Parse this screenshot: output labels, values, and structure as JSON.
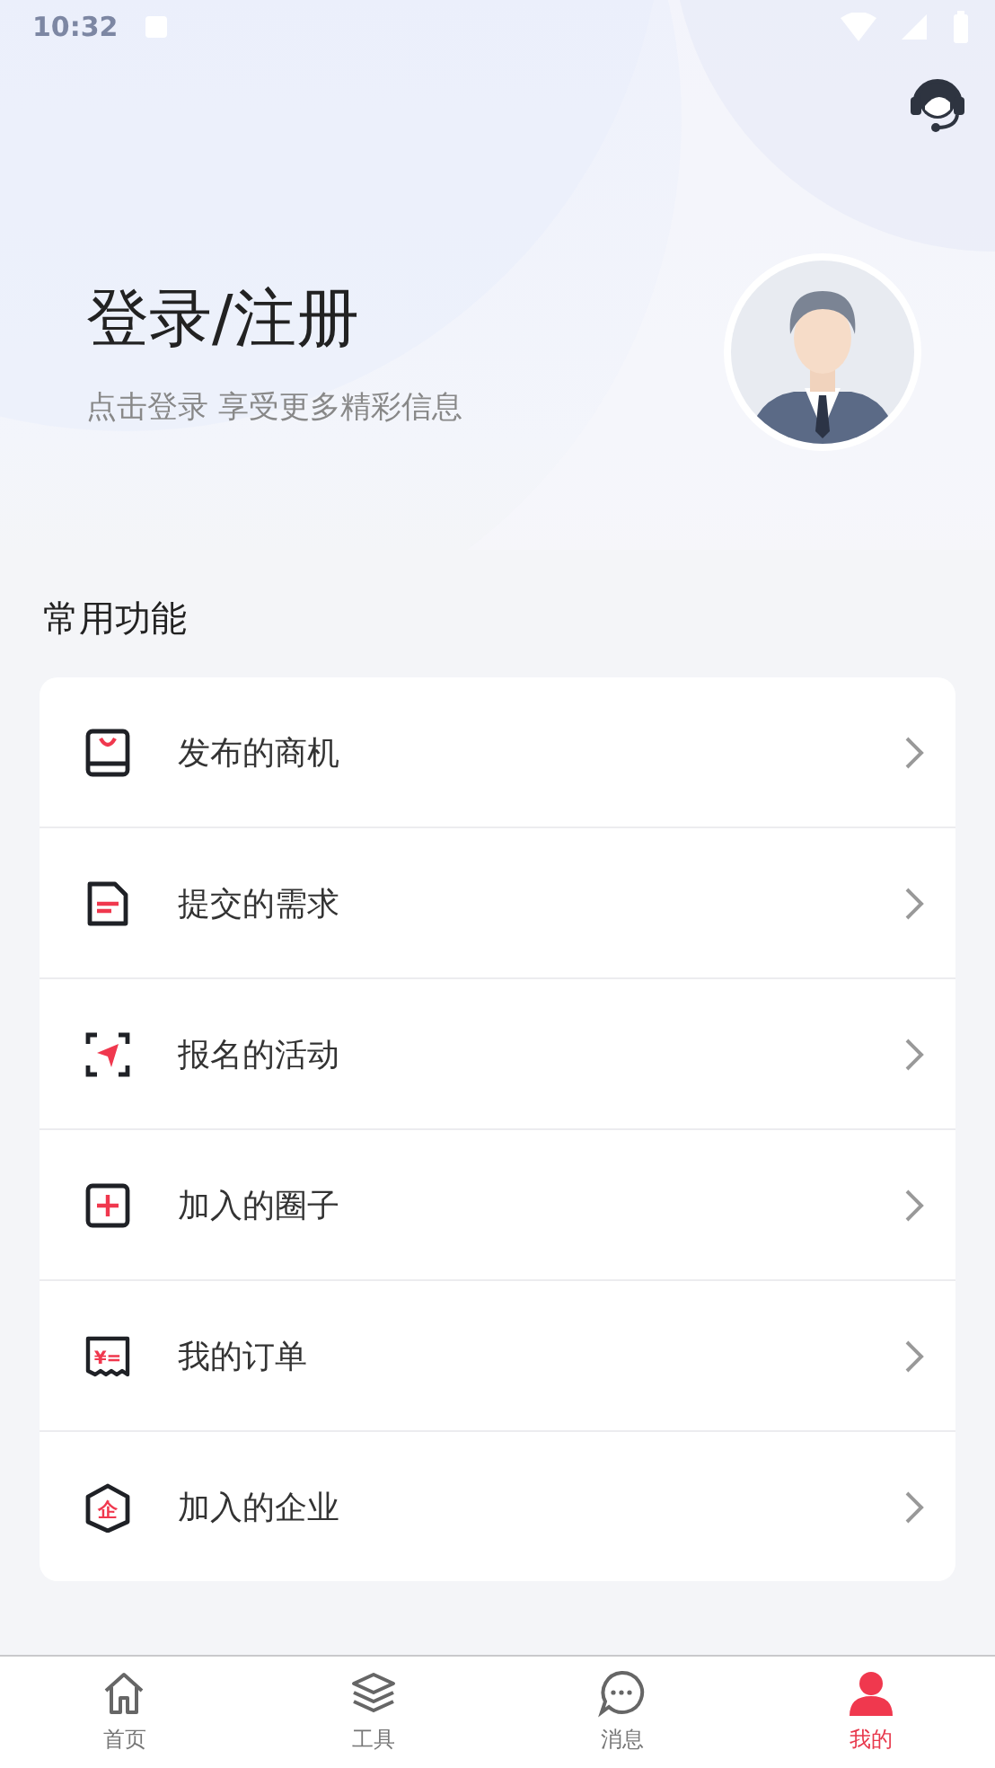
{
  "status_bar": {
    "time": "10:32"
  },
  "profile": {
    "title": "登录/注册",
    "subtitle": "点击登录 享受更多精彩信息"
  },
  "common_section": {
    "title": "常用功能",
    "items": [
      {
        "kind": "bag",
        "label": "发布的商机"
      },
      {
        "kind": "doc",
        "label": "提交的需求"
      },
      {
        "kind": "send",
        "label": "报名的活动"
      },
      {
        "kind": "plus",
        "label": "加入的圈子"
      },
      {
        "kind": "order",
        "label": "我的订单",
        "icon_text": "¥="
      },
      {
        "kind": "company",
        "label": "加入的企业",
        "icon_text": "企"
      }
    ]
  },
  "tab_bar": [
    {
      "kind": "home",
      "label": "首页",
      "selected": false
    },
    {
      "kind": "layers",
      "label": "工具",
      "selected": false
    },
    {
      "kind": "chat",
      "label": "消息",
      "selected": false
    },
    {
      "kind": "person",
      "label": "我的",
      "selected": true
    }
  ]
}
